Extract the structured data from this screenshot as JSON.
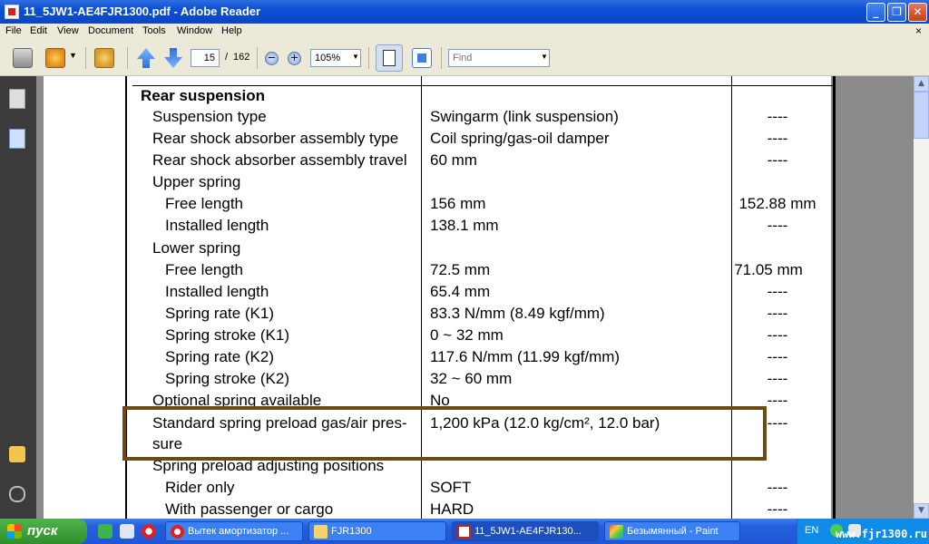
{
  "window": {
    "title": "11_5JW1-AE4FJR1300.pdf - Adobe Reader"
  },
  "menu": {
    "items": [
      "File",
      "Edit",
      "View",
      "Document",
      "Tools",
      "Window",
      "Help"
    ],
    "close_glyph": "×"
  },
  "toolbar": {
    "page_current": "15",
    "page_separator": "/",
    "page_total": "162",
    "zoom": "105%",
    "find_placeholder": "Find"
  },
  "document": {
    "section_title": "Rear suspension",
    "rows": [
      {
        "label": "Suspension type",
        "value": "Swingarm (link suspension)",
        "limit": "----"
      },
      {
        "label": "Rear shock absorber assembly type",
        "value": "Coil spring/gas-oil damper",
        "limit": "----"
      },
      {
        "label": "Rear shock absorber assembly travel",
        "value": "60 mm",
        "limit": "----"
      },
      {
        "label": "Upper spring",
        "value": "",
        "limit": ""
      },
      {
        "label": "Free length",
        "value": "156 mm",
        "limit": "152.88 mm"
      },
      {
        "label": "Installed length",
        "value": "138.1 mm",
        "limit": "----"
      },
      {
        "label": "Lower spring",
        "value": "",
        "limit": ""
      },
      {
        "label": "Free length",
        "value": "72.5 mm",
        "limit": "71.05 mm"
      },
      {
        "label": "Installed length",
        "value": "65.4 mm",
        "limit": "----"
      },
      {
        "label": "Spring rate (K1)",
        "value": "83.3 N/mm (8.49 kgf/mm)",
        "limit": "----"
      },
      {
        "label": "Spring stroke (K1)",
        "value": "0 ~ 32 mm",
        "limit": "----"
      },
      {
        "label": "Spring rate (K2)",
        "value": "117.6 N/mm (11.99 kgf/mm)",
        "limit": "----"
      },
      {
        "label": "Spring stroke (K2)",
        "value": "32 ~ 60 mm",
        "limit": "----"
      },
      {
        "label": "Optional spring available",
        "value": "No",
        "limit": "----"
      },
      {
        "label": "Standard spring preload gas/air pres-",
        "label_cont": "sure",
        "value": "1,200 kPa (12.0 kg/cm², 12.0 bar)",
        "limit": "----"
      },
      {
        "label": "Spring preload adjusting positions",
        "value": "",
        "limit": ""
      },
      {
        "label": "Rider only",
        "value": "SOFT",
        "limit": "----"
      },
      {
        "label": "With passenger or cargo",
        "value": "HARD",
        "limit": "----"
      }
    ]
  },
  "taskbar": {
    "start_label": "пуск",
    "tasks": [
      "Вытек амортизатор ...",
      "FJR1300",
      "11_5JW1-AE4FJR130...",
      "Безымянный - Paint"
    ],
    "tray_lang": "EN",
    "watermark": "www.fjr1300.ru"
  },
  "colors": {
    "highlight_box": "#6e4a12",
    "titlebar": "#0a4fd4",
    "nav_panel": "#3b3b3b"
  }
}
